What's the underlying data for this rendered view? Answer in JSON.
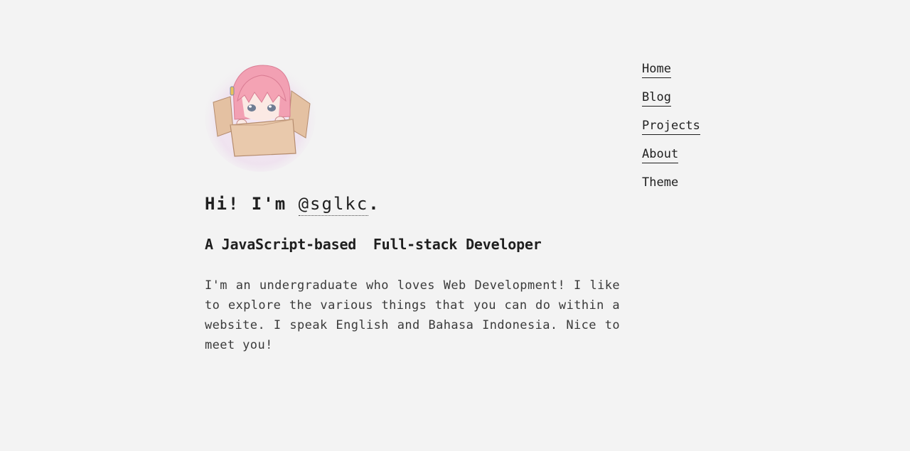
{
  "profile": {
    "greeting_prefix": "Hi! I'm ",
    "handle": "@sglkc",
    "greeting_suffix": ".",
    "tagline": "A JavaScript-based  Full-stack Developer",
    "bio": "I'm an undergraduate who loves Web Development! I like to explore the various things that you can do within a website. I speak English and Bahasa Indonesia. Nice to meet you!",
    "avatar_icon": "chibi-character-in-box-avatar"
  },
  "nav": {
    "items": [
      {
        "label": "Home"
      },
      {
        "label": "Blog"
      },
      {
        "label": "Projects"
      },
      {
        "label": "About"
      },
      {
        "label": "Theme"
      }
    ]
  },
  "colors": {
    "background": "#f3f3f3",
    "text": "#1f1f1f",
    "avatar_hair": "#f4a3b4",
    "avatar_box": "#e9c9ac"
  }
}
